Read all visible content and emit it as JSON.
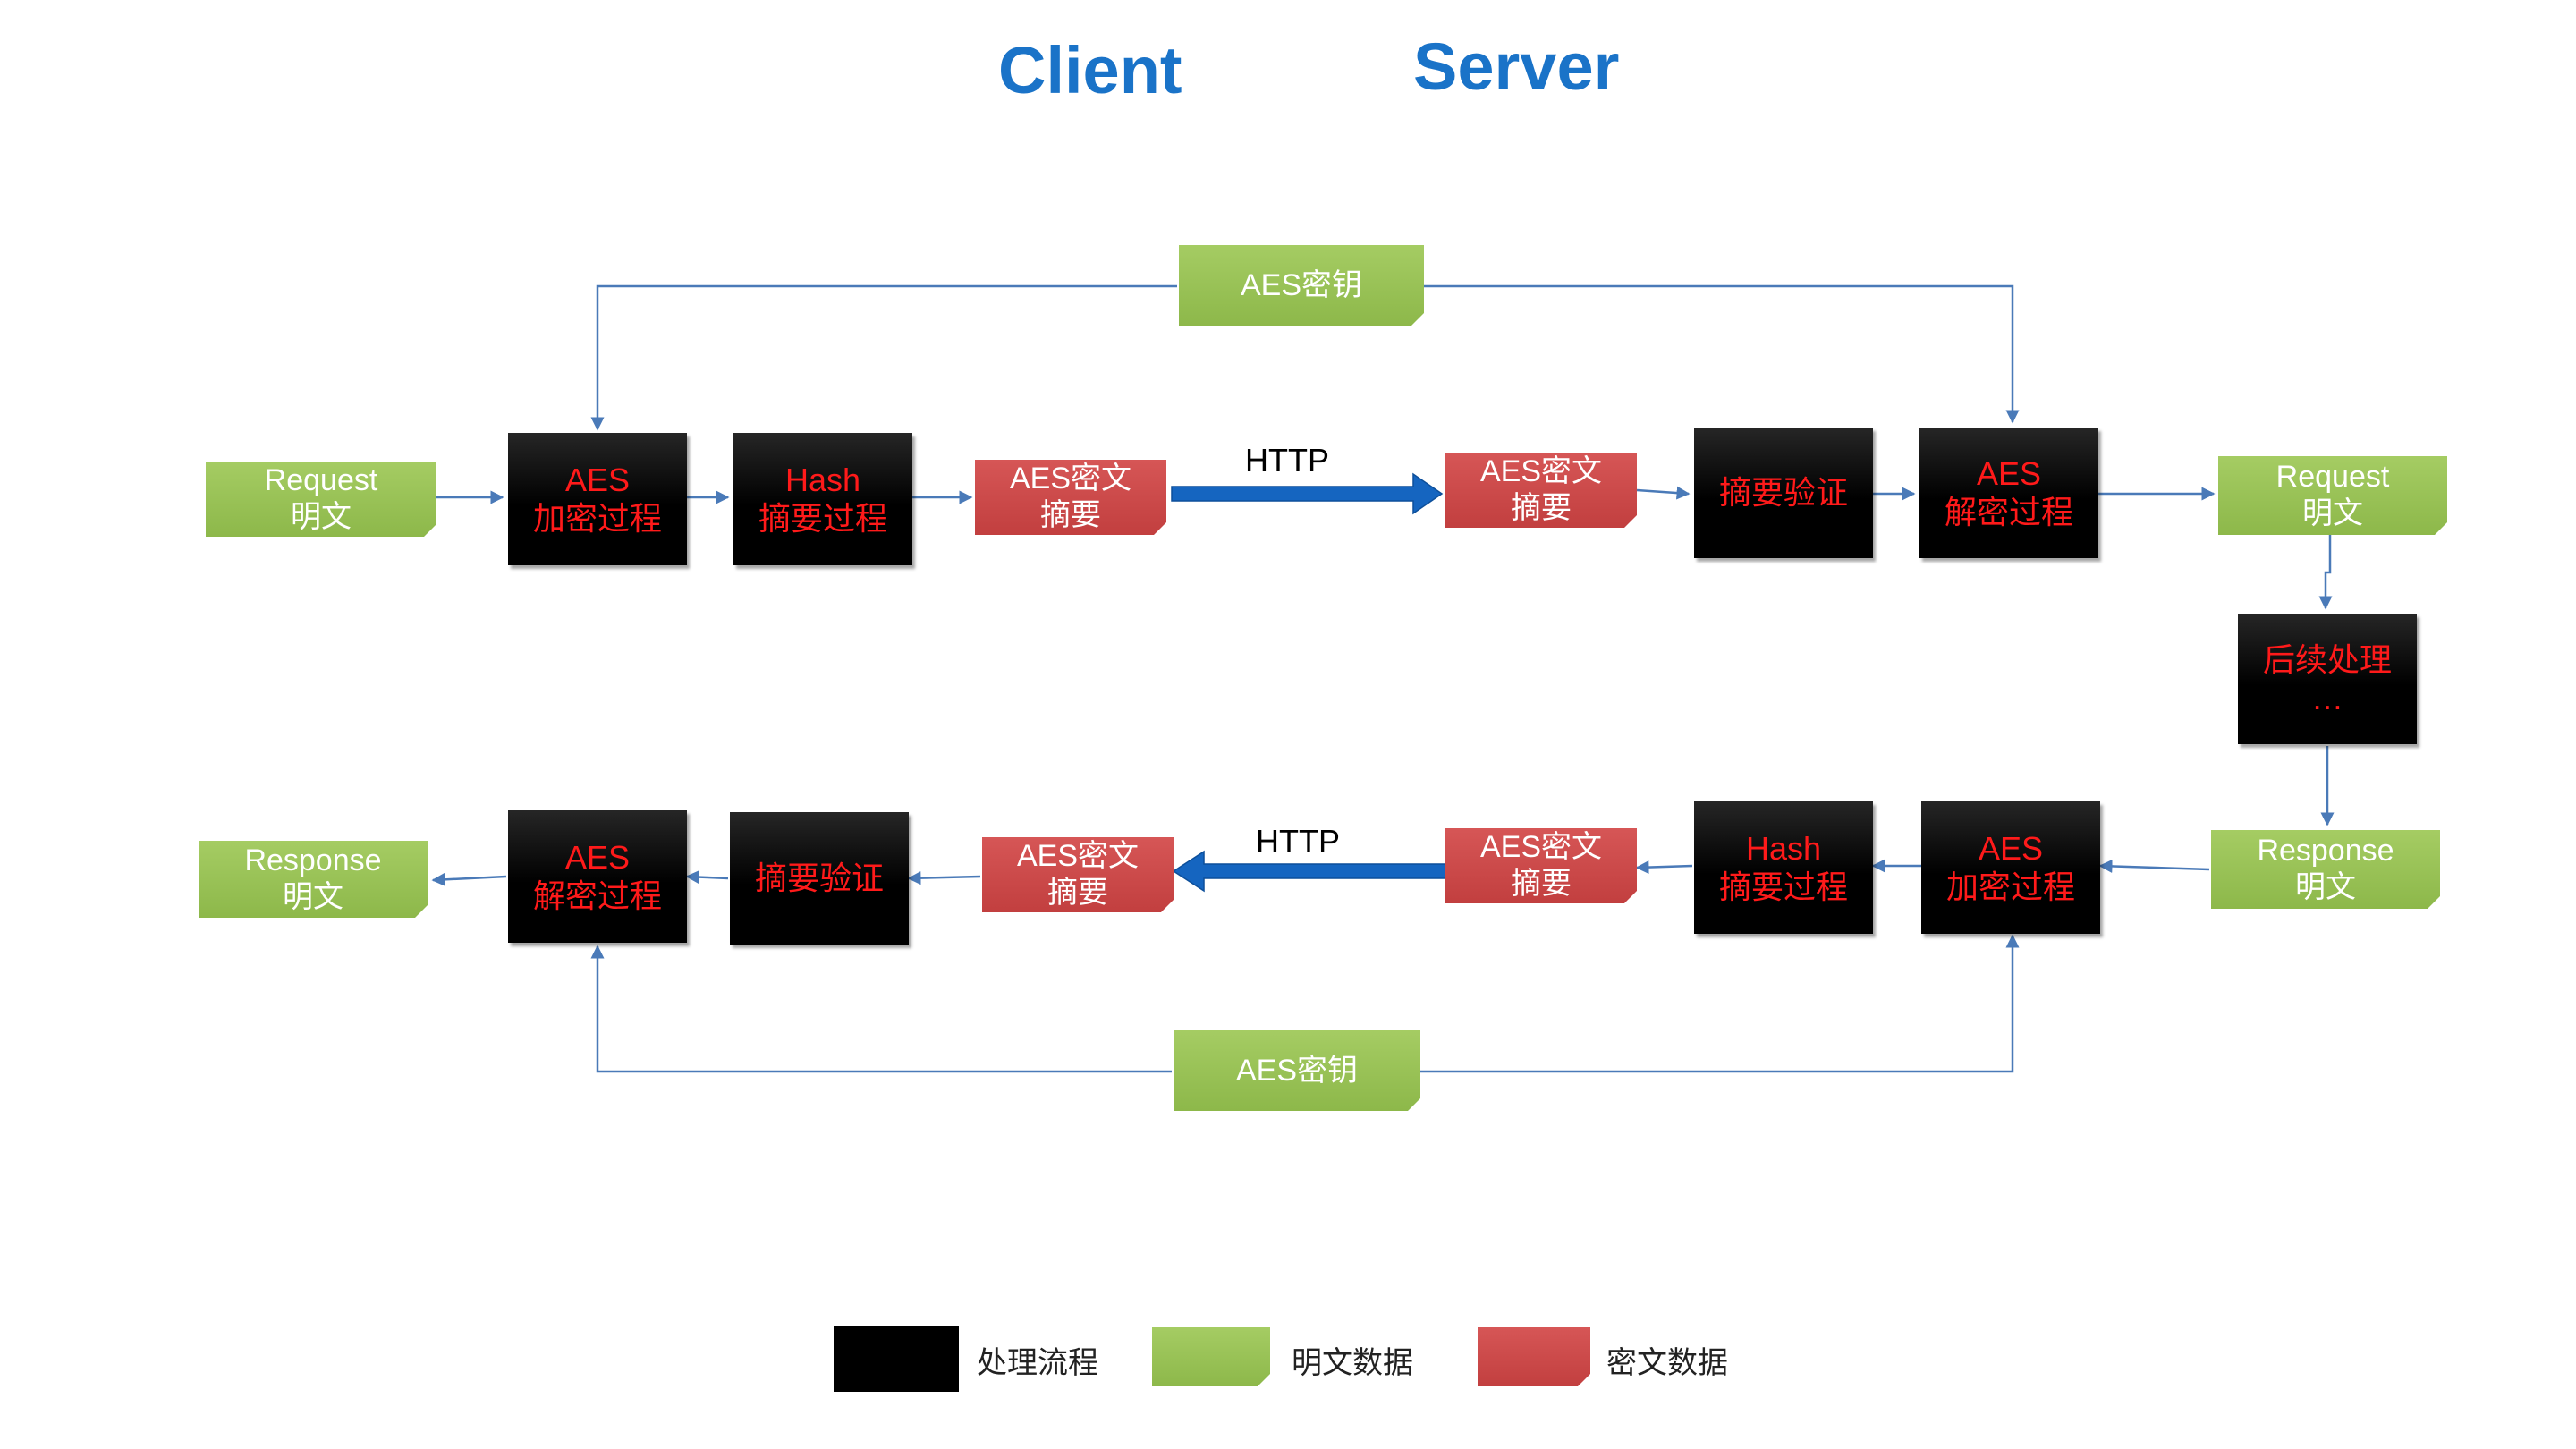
{
  "titles": {
    "client": "Client",
    "server": "Server"
  },
  "colors": {
    "title": "#1a73c8",
    "process_text": "#ff1a1a",
    "plain": "#9bc356",
    "cipher": "#cc4a4a",
    "connector": "#4a7ab8",
    "http_arrow": "#1565c0"
  },
  "top_flow": {
    "key": "AES密钥",
    "request_plain": {
      "line1": "Request",
      "line2": "明文"
    },
    "encrypt": {
      "line1": "AES",
      "line2": "加密过程"
    },
    "hash": {
      "line1": "Hash",
      "line2": "摘要过程"
    },
    "cipher_client": {
      "line1": "AES密文",
      "line2": "摘要"
    },
    "http": "HTTP",
    "cipher_server": {
      "line1": "AES密文",
      "line2": "摘要"
    },
    "verify": "摘要验证",
    "decrypt": {
      "line1": "AES",
      "line2": "解密过程"
    },
    "request_plain_server": {
      "line1": "Request",
      "line2": "明文"
    }
  },
  "middle": {
    "line1": "后续处理",
    "line2": "…"
  },
  "bottom_flow": {
    "response_plain_server": {
      "line1": "Response",
      "line2": "明文"
    },
    "encrypt": {
      "line1": "AES",
      "line2": "加密过程"
    },
    "hash": {
      "line1": "Hash",
      "line2": "摘要过程"
    },
    "cipher_server": {
      "line1": "AES密文",
      "line2": "摘要"
    },
    "http": "HTTP",
    "cipher_client": {
      "line1": "AES密文",
      "line2": "摘要"
    },
    "verify": "摘要验证",
    "decrypt": {
      "line1": "AES",
      "line2": "解密过程"
    },
    "response_plain_client": {
      "line1": "Response",
      "line2": "明文"
    },
    "key": "AES密钥"
  },
  "legend": {
    "process": "处理流程",
    "plain": "明文数据",
    "cipher": "密文数据"
  }
}
